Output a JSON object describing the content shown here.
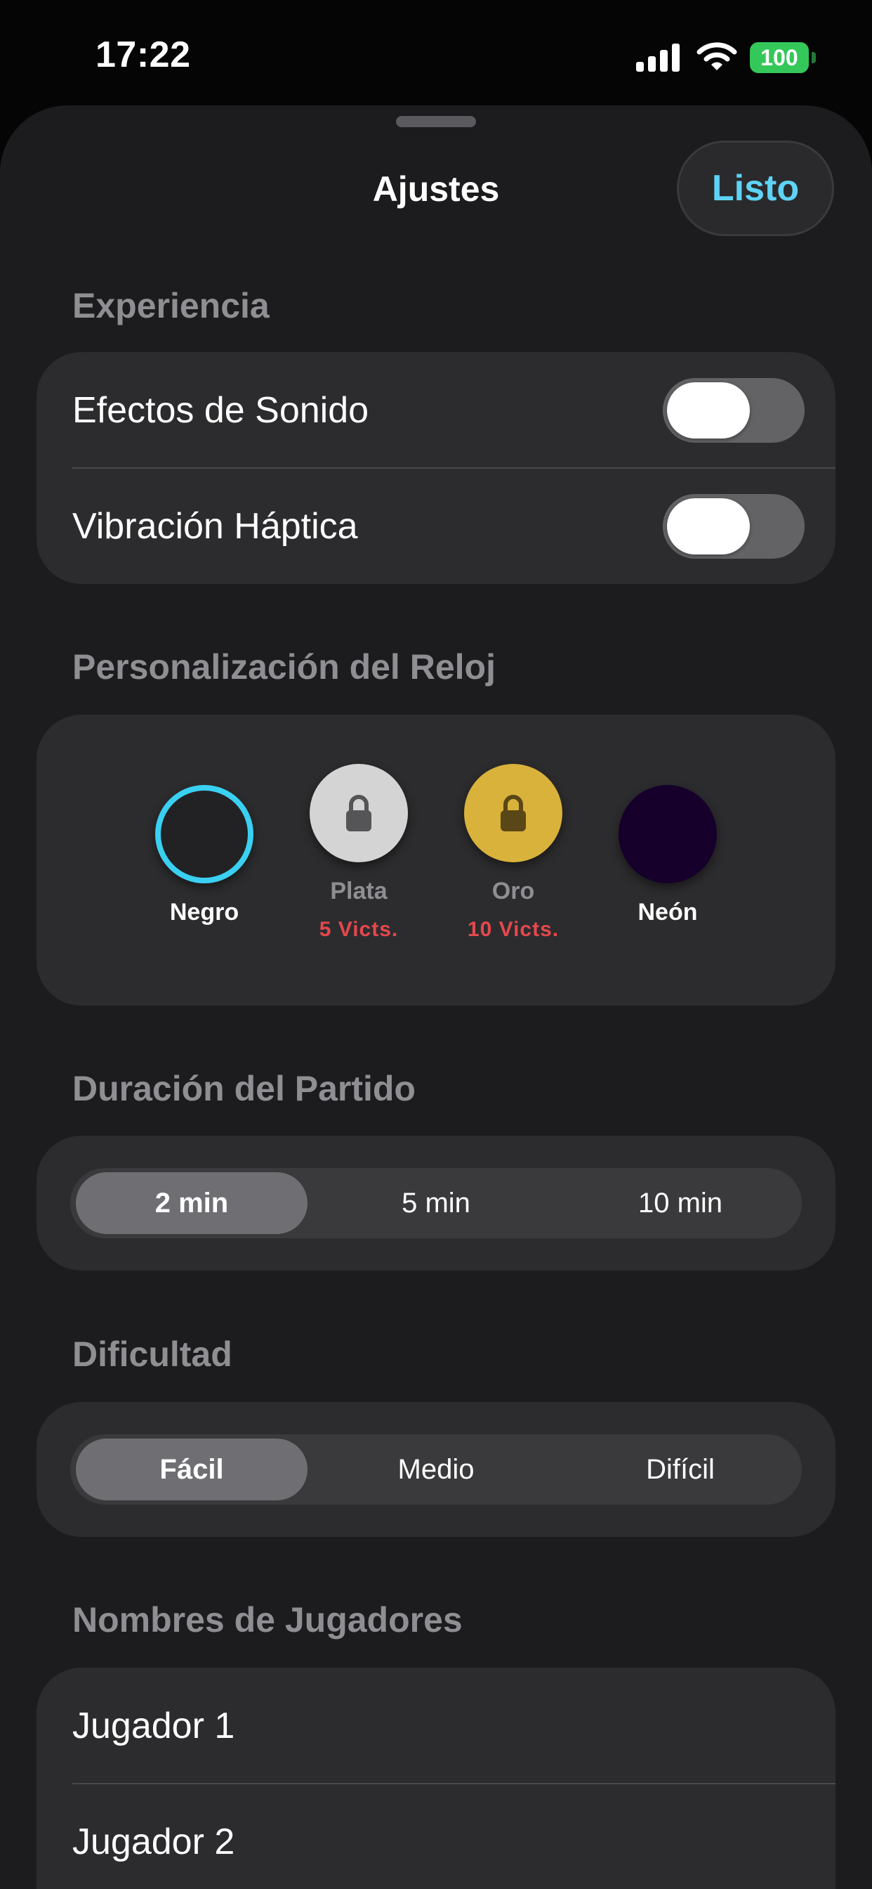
{
  "status_bar": {
    "time": "17:22",
    "battery": "100",
    "icons": [
      "signal-icon",
      "wifi-icon",
      "battery-icon"
    ]
  },
  "sheet": {
    "title": "Ajustes",
    "done_label": "Listo"
  },
  "colors": {
    "accent": "#5ed3f5",
    "sheet_bg": "#1c1c1e",
    "card_bg": "#2c2c2e",
    "locked_text": "#e5484d",
    "battery": "#34c759"
  },
  "experience": {
    "header": "Experiencia",
    "rows": [
      {
        "label": "Efectos de Sonido",
        "on": true
      },
      {
        "label": "Vibración Háptica",
        "on": true
      }
    ]
  },
  "clock": {
    "header": "Personalización del Reloj",
    "themes": [
      {
        "name": "Negro",
        "requirement": "",
        "locked": false,
        "selected": true,
        "color": "#222224",
        "name_color": "#ffffff"
      },
      {
        "name": "Plata",
        "requirement": "5 Victs.",
        "locked": true,
        "selected": false,
        "color": "#d4d4d4",
        "name_color": "#8e8e93"
      },
      {
        "name": "Oro",
        "requirement": "10 Victs.",
        "locked": true,
        "selected": false,
        "color": "#d9b23b",
        "name_color": "#8e8e93"
      },
      {
        "name": "Neón",
        "requirement": "",
        "locked": false,
        "selected": false,
        "color": "#16002b",
        "name_color": "#ffffff"
      }
    ]
  },
  "duration": {
    "header": "Duración del Partido",
    "options": [
      "2 min",
      "5 min",
      "10 min"
    ],
    "selected": "2 min"
  },
  "difficulty": {
    "header": "Dificultad",
    "options": [
      "Fácil",
      "Medio",
      "Difícil"
    ],
    "selected": "Fácil"
  },
  "players": {
    "header": "Nombres de Jugadores",
    "names": [
      "Jugador 1",
      "Jugador 2"
    ]
  }
}
